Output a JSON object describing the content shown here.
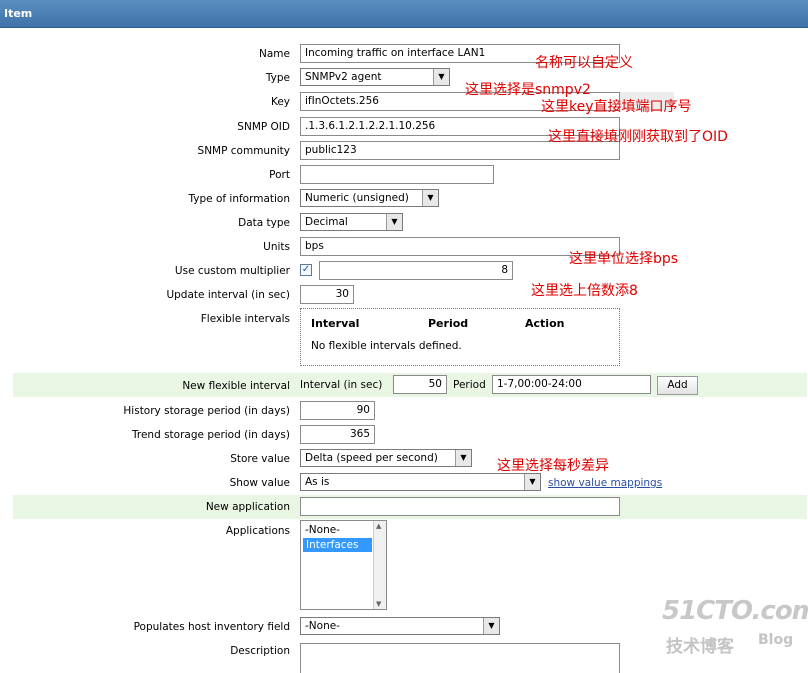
{
  "header": {
    "title": "Item"
  },
  "fields": {
    "name": {
      "label": "Name",
      "value": "Incoming traffic on interface LAN1"
    },
    "type": {
      "label": "Type",
      "value": "SNMPv2 agent"
    },
    "key": {
      "label": "Key",
      "value": "ifInOctets.256"
    },
    "snmp_oid": {
      "label": "SNMP OID",
      "value": ".1.3.6.1.2.1.2.2.1.10.256"
    },
    "snmp_community": {
      "label": "SNMP community",
      "value": "public123"
    },
    "port": {
      "label": "Port",
      "value": ""
    },
    "type_of_information": {
      "label": "Type of information",
      "value": "Numeric (unsigned)"
    },
    "data_type": {
      "label": "Data type",
      "value": "Decimal"
    },
    "units": {
      "label": "Units",
      "value": "bps"
    },
    "custom_multiplier": {
      "label": "Use custom multiplier",
      "value": "8",
      "checked": true
    },
    "update_interval": {
      "label": "Update interval (in sec)",
      "value": "30"
    },
    "flexible_intervals": {
      "label": "Flexible intervals",
      "columns": [
        "Interval",
        "Period",
        "Action"
      ],
      "empty_text": "No flexible intervals defined."
    },
    "new_flexible_interval": {
      "label": "New flexible interval",
      "interval_label": "Interval (in sec)",
      "interval_value": "50",
      "period_label": "Period",
      "period_value": "1-7,00:00-24:00",
      "add_button": "Add"
    },
    "history": {
      "label": "History storage period (in days)",
      "value": "90"
    },
    "trend": {
      "label": "Trend storage period (in days)",
      "value": "365"
    },
    "store_value": {
      "label": "Store value",
      "value": "Delta (speed per second)"
    },
    "show_value": {
      "label": "Show value",
      "value": "As is",
      "link": "show value mappings"
    },
    "new_application": {
      "label": "New application",
      "value": ""
    },
    "applications": {
      "label": "Applications",
      "options": [
        "-None-",
        "Interfaces"
      ],
      "selected": "Interfaces"
    },
    "inventory": {
      "label": "Populates host inventory field",
      "value": "-None-"
    },
    "description": {
      "label": "Description",
      "value": ""
    }
  },
  "annotations": {
    "name": "名称可以自定义",
    "type": "这里选择是snmpv2",
    "key": "这里key直接填端口序号",
    "oid": "这里直接填刚刚获取到了OID",
    "units": "这里单位选择bps",
    "multiplier": "这里选上倍数添8",
    "store": "这里选择每秒差异"
  },
  "watermark": {
    "line1": "51CTO.com",
    "line2": "技术博客",
    "line3": "Blog"
  },
  "colors": {
    "header": "#4a7fb5",
    "annotation": "#e00000",
    "row_highlight": "#eaf6e4",
    "selected": "#3399ff"
  }
}
